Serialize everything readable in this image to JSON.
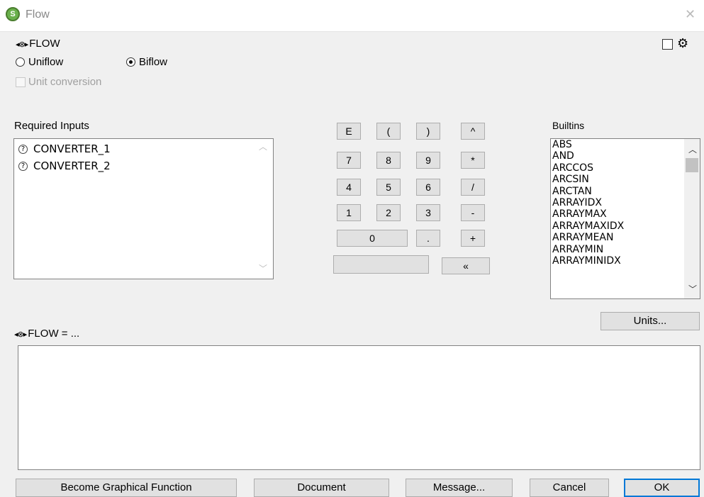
{
  "window": {
    "title": "Flow",
    "app_badge": "S",
    "close_glyph": "✕"
  },
  "header": {
    "name": "FLOW",
    "top_right_checkbox_checked": false,
    "top_right_icon": "gear-icon"
  },
  "flow_type": {
    "uniflow_label": "Uniflow",
    "biflow_label": "Biflow",
    "selected": "Biflow"
  },
  "unit_conversion": {
    "label": "Unit conversion",
    "enabled": false,
    "checked": false
  },
  "required_inputs": {
    "label": "Required Inputs",
    "items": [
      "CONVERTER_1",
      "CONVERTER_2"
    ],
    "item_icon": "question-circle-icon"
  },
  "keypad": {
    "row1": [
      "E",
      "(",
      ")",
      "^"
    ],
    "row2": [
      "7",
      "8",
      "9",
      "*"
    ],
    "row3": [
      "4",
      "5",
      "6",
      "/"
    ],
    "row4": [
      "1",
      "2",
      "3",
      "-"
    ],
    "zero": "0",
    "dot": ".",
    "plus": "+",
    "blank": "",
    "backspace": "«"
  },
  "builtins": {
    "label": "Builtins",
    "items": [
      "ABS",
      "AND",
      "ARCCOS",
      "ARCSIN",
      "ARCTAN",
      "ARRAYIDX",
      "ARRAYMAX",
      "ARRAYMAXIDX",
      "ARRAYMEAN",
      "ARRAYMIN",
      "ARRAYMINIDX"
    ]
  },
  "units_button": "Units...",
  "equation": {
    "label": "FLOW = ...",
    "value": ""
  },
  "footer": {
    "graphical_function": "Become Graphical Function",
    "document": "Document",
    "message": "Message...",
    "cancel": "Cancel",
    "ok": "OK"
  },
  "colors": {
    "accent": "#0078d7",
    "badge": "#6ab04c"
  }
}
